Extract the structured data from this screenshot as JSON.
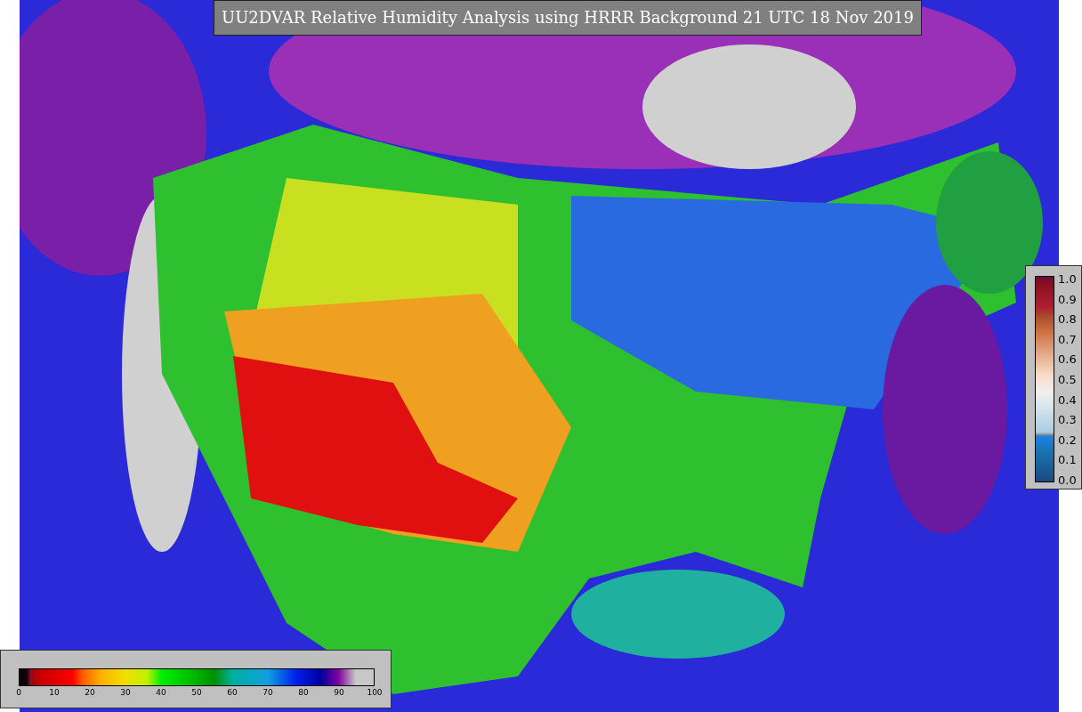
{
  "title": "UU2DVAR Relative Humidity Analysis using HRRR Background 21 UTC 18 Nov 2019",
  "observation_legend": {
    "ticks": [
      "1.0",
      "0.9",
      "0.8",
      "0.7",
      "0.6",
      "0.5",
      "0.4",
      "0.3",
      "0.2",
      "0.1",
      "0.0"
    ]
  },
  "humidity_legend": {
    "ticks": [
      "0",
      "10",
      "20",
      "30",
      "40",
      "50",
      "60",
      "70",
      "80",
      "90",
      "100"
    ]
  }
}
